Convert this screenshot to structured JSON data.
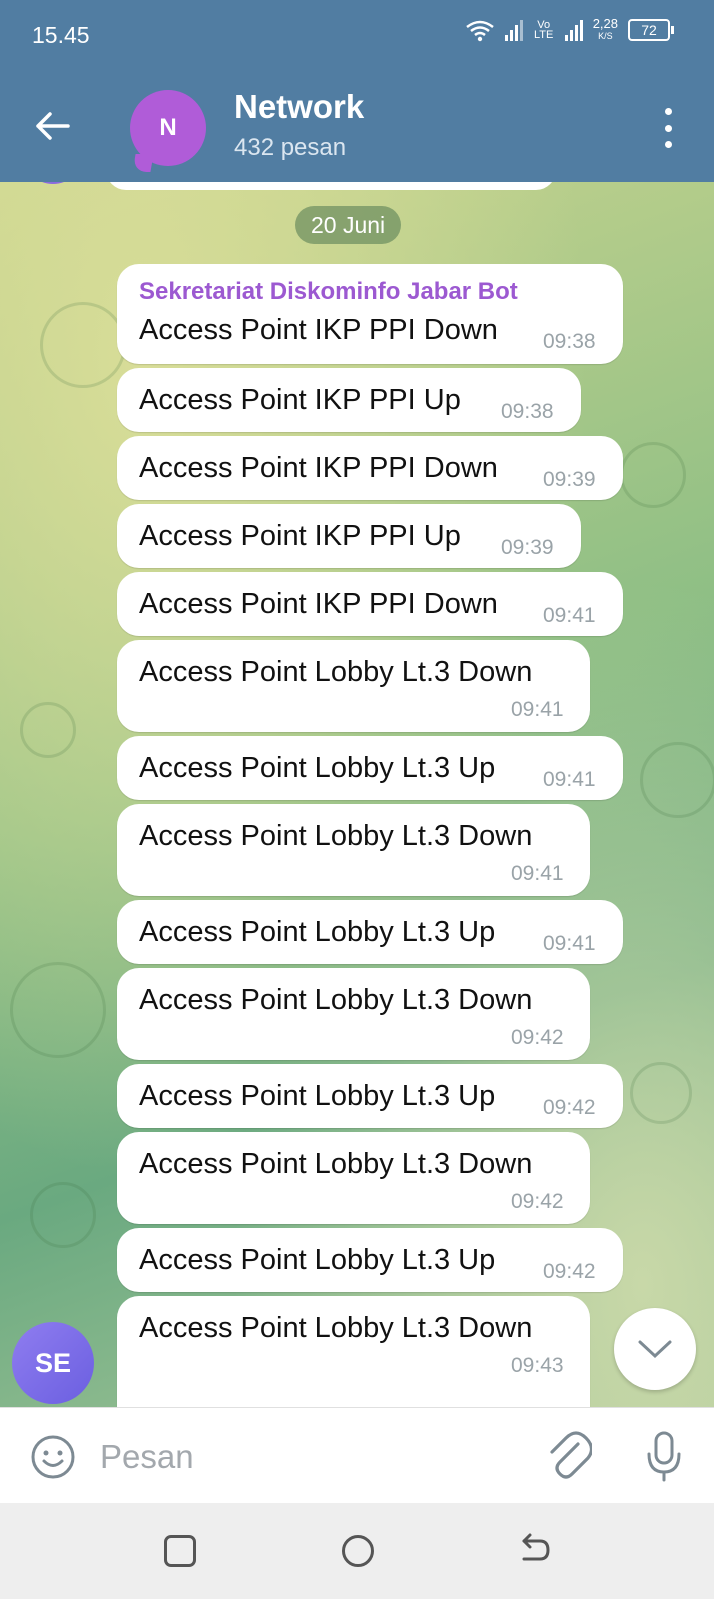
{
  "status_bar": {
    "time": "15.45",
    "network_label": "Vo LTE",
    "speed": "2,28",
    "speed_unit": "K/S",
    "battery": "72"
  },
  "header": {
    "avatar_letter": "N",
    "title": "Network",
    "subtitle": "432 pesan",
    "avatar_color": "#b05cd8"
  },
  "chat": {
    "date_chip": "20 Juni",
    "sender": "Sekretariat Diskominfo Jabar Bot",
    "sender_color": "#9c59d1",
    "messages": [
      {
        "text": "Access Point IKP PPI Down",
        "time": "09:38"
      },
      {
        "text": "Access Point IKP PPI Up",
        "time": "09:38"
      },
      {
        "text": "Access Point IKP PPI Down",
        "time": "09:39"
      },
      {
        "text": "Access Point IKP PPI Up",
        "time": "09:39"
      },
      {
        "text": "Access Point IKP PPI Down",
        "time": "09:41"
      },
      {
        "text": "Access Point Lobby Lt.3 Down",
        "time": "09:41"
      },
      {
        "text": "Access Point Lobby Lt.3 Up",
        "time": "09:41"
      },
      {
        "text": "Access Point Lobby Lt.3 Down",
        "time": "09:41"
      },
      {
        "text": "Access Point Lobby Lt.3 Up",
        "time": "09:41"
      },
      {
        "text": "Access Point Lobby Lt.3 Down",
        "time": "09:42"
      },
      {
        "text": "Access Point Lobby Lt.3 Up",
        "time": "09:42"
      },
      {
        "text": "Access Point Lobby Lt.3 Down",
        "time": "09:42"
      },
      {
        "text": "Access Point Lobby Lt.3 Up",
        "time": "09:42"
      },
      {
        "text": "Access Point Lobby Lt.3 Down",
        "time": "09:43"
      }
    ],
    "sender_avatar": "SE"
  },
  "input": {
    "placeholder": "Pesan"
  },
  "icons": {
    "back": "arrow-left-icon",
    "menu": "more-vert-icon",
    "emoji": "smiley-icon",
    "attach": "paperclip-icon",
    "mic": "microphone-icon",
    "scroll": "chevron-down-icon"
  }
}
